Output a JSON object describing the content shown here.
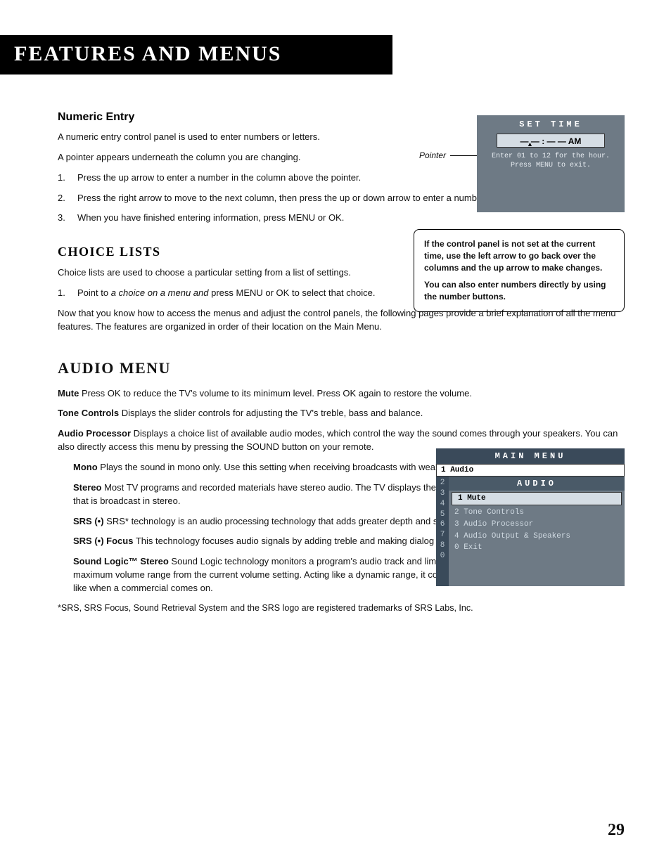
{
  "header": {
    "title": "Features and Menus"
  },
  "numeric": {
    "heading": "Numeric Entry",
    "p1": "A numeric entry control panel is used to enter numbers or letters.",
    "p2": "A pointer appears underneath the column you are changing.",
    "steps": {
      "s1n": "1.",
      "s1": "Press the up arrow to enter a number in the column above the pointer.",
      "s2n": "2.",
      "s2": "Press the right arrow to move to the next column, then press the up or down arrow to enter a number.",
      "s3n": "3.",
      "s3": "When you have finished entering information, press MENU or OK."
    }
  },
  "choice": {
    "heading": "Choice Lists",
    "p1": "Choice lists are used to choose a particular setting from a list of settings.",
    "s1n": "1.",
    "s1a": "Point to ",
    "s1i": "a choice on a menu and",
    "s1b": " press MENU or OK to select that choice.",
    "p2": "Now that you know how to access the menus and adjust the control panels, the following pages provide a brief explanation of all the menu features. The features are organized in order of their location on the Main Menu."
  },
  "audio": {
    "heading": "Audio Menu",
    "mute_t": "Mute",
    "mute": "  Press OK to reduce the TV's volume to its minimum level. Press OK again to restore the volume.",
    "tone_t": "Tone Controls",
    "tone": "  Displays the slider controls for adjusting the TV's treble, bass and balance.",
    "proc_t": "Audio Processor",
    "proc": "  Displays a choice list of available audio modes, which control the way the sound comes through your speakers. You can also directly access this menu by pressing the SOUND button on your remote.",
    "mono_t": "Mono",
    "mono": "  Plays the sound in mono only. Use this setting when receiving broadcasts with weak stereo signals.",
    "stereo_t": "Stereo",
    "stereo": "   Most TV programs and recorded materials have stereo audio. The TV displays the word STEREO when you tune to a program that is broadcast in stereo.",
    "srs_t": "SRS (•)",
    "srs": "  SRS* technology is an audio processing technology that adds greater depth and stereo separation to stereo audio signals.",
    "srsf_t": "SRS (•) Focus",
    "srsf": "  This technology focuses audio signals by adding treble and making dialog more understandable.",
    "sl_t": "Sound Logic™ Stereo",
    "sl": "   Sound Logic technology monitors a program's audio track and limits volume excursions to a minimum and maximum volume range from the current volume setting. Acting like a dynamic range, it compresses to limit sudden volume increases, like when a commercial comes on.",
    "foot": "*SRS, SRS Focus, Sound Retrieval System and the SRS logo are registered trademarks of SRS Labs, Inc."
  },
  "osd_time": {
    "pointer": "Pointer",
    "title": "SET TIME",
    "value": "— — : — —  AM",
    "hint1": "Enter 01 to 12 for the hour.",
    "hint2": "Press MENU to exit."
  },
  "note": {
    "p1": "If the control panel is not set at the current time, use the left arrow to go back over the columns and the up arrow to make changes.",
    "p2": "You can also enter numbers directly by using the number buttons."
  },
  "menu_osd": {
    "main": "MAIN MENU",
    "row1": "1 Audio",
    "nums": [
      "2",
      "3",
      "4",
      "5",
      "6",
      "7",
      "8",
      "0"
    ],
    "sub_title": "AUDIO",
    "items": {
      "i1": "1 Mute",
      "i2": "2 Tone Controls",
      "i3": "3 Audio Processor",
      "i4": "4 Audio Output & Speakers",
      "i0": "0 Exit"
    }
  },
  "page": "29"
}
